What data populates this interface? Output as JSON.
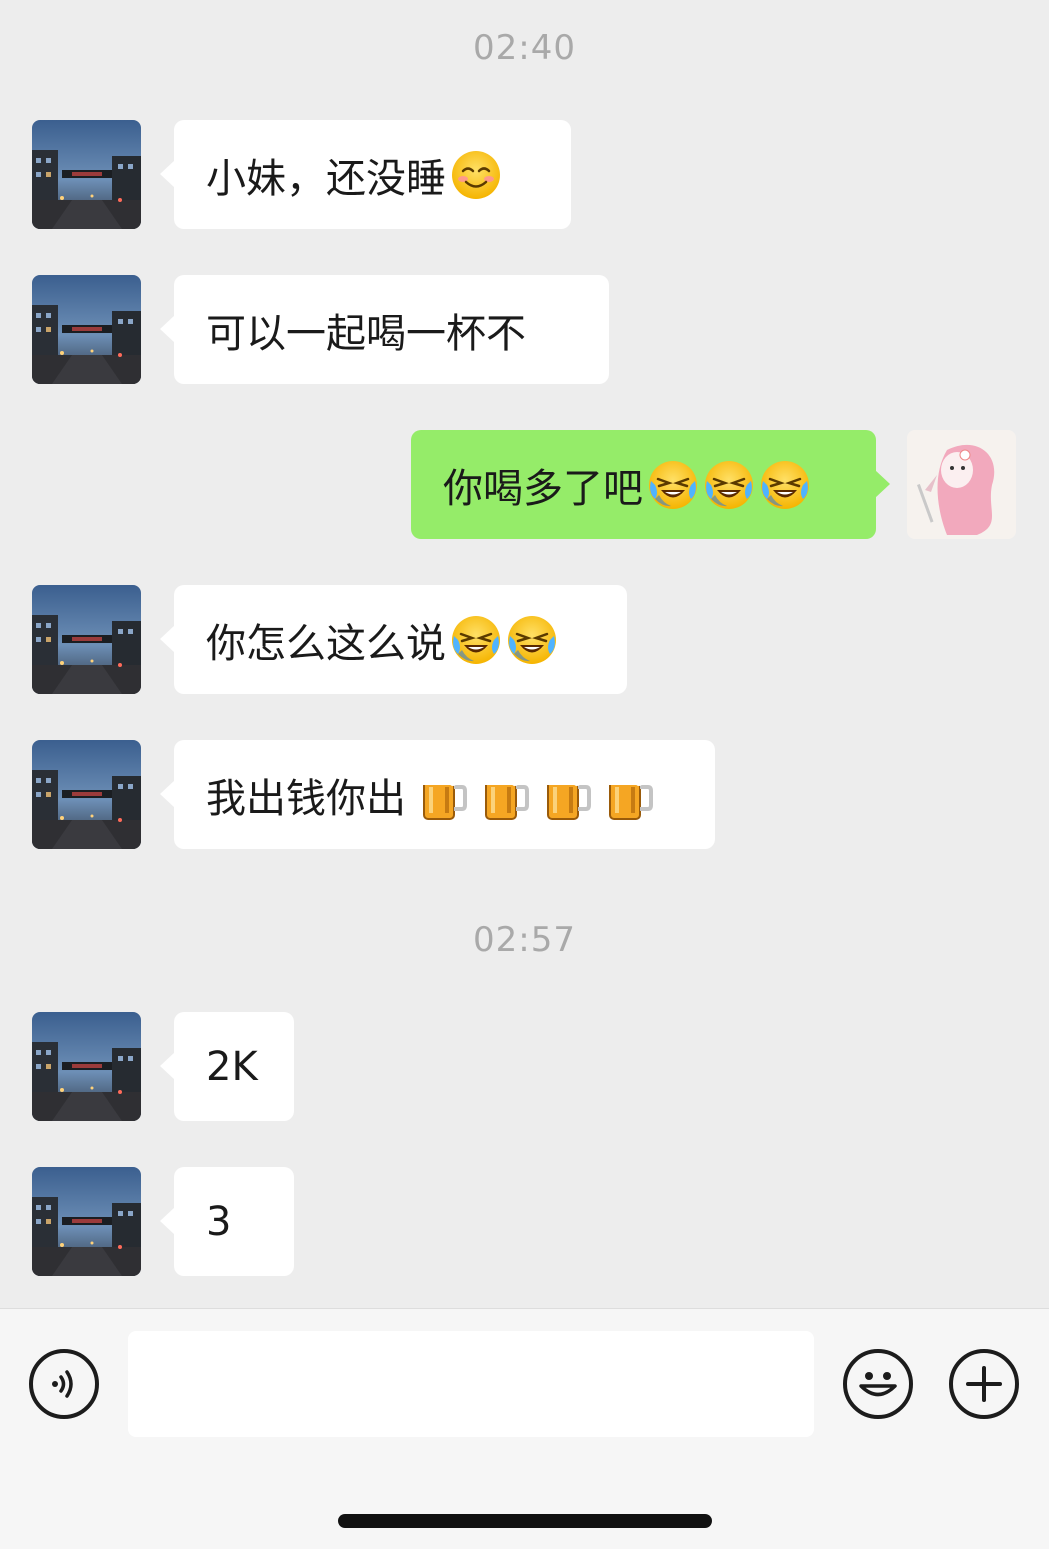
{
  "colors": {
    "background": "#ededed",
    "incoming_bubble": "#ffffff",
    "outgoing_bubble": "#95ec69",
    "timestamp": "#a9a9a9"
  },
  "timestamps": [
    "02:40",
    "02:57"
  ],
  "messages": [
    {
      "sender": "contact",
      "text": "小妹，还没睡",
      "emojis": [
        "smiling-face-icon"
      ]
    },
    {
      "sender": "contact",
      "text": "可以一起喝一杯不",
      "emojis": []
    },
    {
      "sender": "me",
      "text": "你喝多了吧",
      "emojis": [
        "crying-laughing-icon",
        "crying-laughing-icon",
        "crying-laughing-icon"
      ]
    },
    {
      "sender": "contact",
      "text": "你怎么这么说",
      "emojis": [
        "crying-laughing-icon",
        "crying-laughing-icon"
      ]
    },
    {
      "sender": "contact",
      "text": "我出钱你出",
      "emojis": [
        "beer-mug-icon",
        "beer-mug-icon",
        "beer-mug-icon",
        "beer-mug-icon"
      ]
    },
    {
      "sender": "contact",
      "text": "2K",
      "emojis": []
    },
    {
      "sender": "contact",
      "text": "3",
      "emojis": []
    }
  ],
  "input_bar": {
    "voice_icon": "voice-icon",
    "input_value": "",
    "emoji_icon": "emoji-icon",
    "plus_icon": "plus-icon"
  }
}
